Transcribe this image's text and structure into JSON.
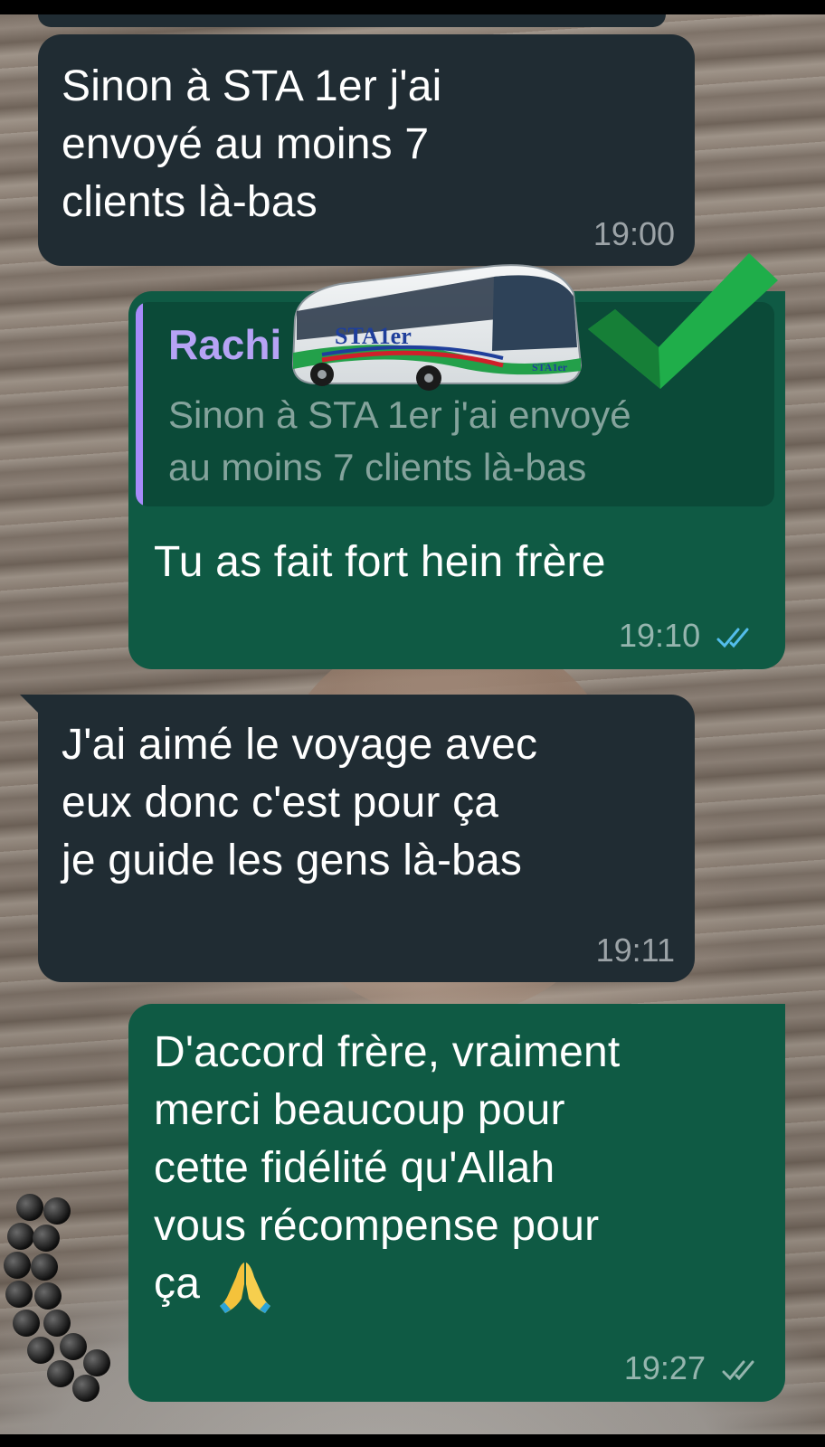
{
  "messages": [
    {
      "direction": "incoming",
      "text_lines": [
        "Sinon à STA 1er j'ai",
        "envoyé au moins 7",
        "clients là-bas"
      ],
      "time": "19:00"
    },
    {
      "direction": "outgoing",
      "quoted": {
        "author": "Rachi",
        "text_lines": [
          "Sinon à STA 1er j'ai envoyé",
          "au moins 7 clients là-bas"
        ]
      },
      "text_lines": [
        "Tu as fait fort hein frère"
      ],
      "time": "19:10",
      "status_icon": "double-check-read-icon"
    },
    {
      "direction": "incoming",
      "text_lines": [
        "J'ai aimé le voyage avec",
        "eux donc c'est pour ça",
        "je  guide les gens là-bas"
      ],
      "time": "19:11"
    },
    {
      "direction": "outgoing",
      "text_lines": [
        "D'accord frère, vraiment",
        "merci beaucoup pour",
        "cette fidélité qu'Allah",
        "vous récompense pour",
        "ça"
      ],
      "emoji": "folded-hands-icon",
      "time": "19:27",
      "status_icon": "double-check-delivered-icon"
    }
  ],
  "overlay": {
    "bus_logo_text": "STA1er",
    "bus_side_text": "STA1er",
    "sticker_icon": "green-check-icon"
  },
  "colors": {
    "incoming_bubble": "#202c33",
    "outgoing_bubble": "#0f5a44",
    "quote_author": "#b6a3f5",
    "read_ticks": "#53bdeb"
  }
}
